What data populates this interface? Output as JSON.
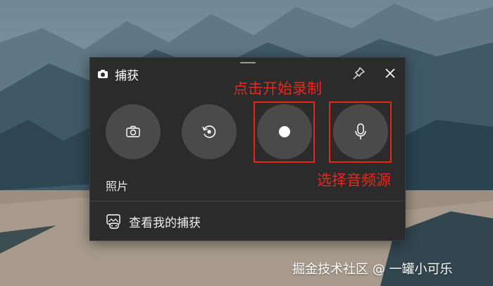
{
  "widget": {
    "title": "捕获",
    "title_icon": "camera-icon",
    "pin_icon": "pin-icon",
    "close_icon": "close-icon",
    "buttons": [
      {
        "name": "screenshot",
        "icon": "camera-icon"
      },
      {
        "name": "record-last",
        "icon": "replay-icon"
      },
      {
        "name": "start-recording",
        "icon": "record-dot-icon"
      },
      {
        "name": "audio-source",
        "icon": "microphone-icon"
      }
    ],
    "photo_label": "照片",
    "gallery_label": "查看我的捕获",
    "gallery_icon": "gallery-controller-icon"
  },
  "annotations": {
    "record_label": "点击开始录制",
    "mic_label": "选择音频源",
    "color": "#e0291c"
  },
  "watermark": "掘金技术社区 @ 一罐小可乐",
  "colors": {
    "panel": "#2b2b2b",
    "button": "#4a4a4a",
    "accent_red": "#e8281c"
  }
}
